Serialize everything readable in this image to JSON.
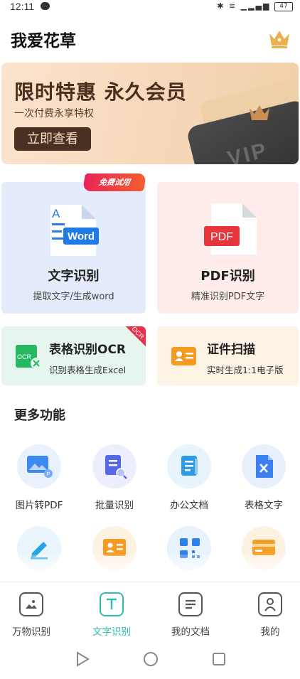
{
  "status_bar": {
    "time": "12:11",
    "battery": "47"
  },
  "header": {
    "title": "我爱花草"
  },
  "banner": {
    "title": "限时特惠 永久会员",
    "subtitle": "一次付费永享特权",
    "button_label": "立即查看",
    "card_text": "VIP"
  },
  "main_features": [
    {
      "title": "文字识别",
      "subtitle": "提取文字/生成word",
      "icon_text": "Word",
      "tag": "免费试用"
    },
    {
      "title": "PDF识别",
      "subtitle": "精准识别PDF文字",
      "icon_text": "PDF"
    }
  ],
  "secondary_features": [
    {
      "title": "表格识别OCR",
      "subtitle": "识别表格生成Excel",
      "corner_tag": "OCR",
      "icon_text": "OCR"
    },
    {
      "title": "证件扫描",
      "subtitle": "实时生成1:1电子版"
    }
  ],
  "more": {
    "title": "更多功能",
    "items": [
      {
        "label": "图片转PDF",
        "icon": "image-to-pdf-icon"
      },
      {
        "label": "批量识别",
        "icon": "batch-scan-icon"
      },
      {
        "label": "办公文档",
        "icon": "office-doc-icon"
      },
      {
        "label": "表格文字",
        "icon": "excel-text-icon"
      }
    ],
    "row2_icons": [
      "handwriting-icon",
      "id-card-icon",
      "qr-code-icon",
      "bank-card-icon"
    ]
  },
  "bottom_nav": [
    {
      "label": "万物识别",
      "icon": "photo-icon",
      "active": false
    },
    {
      "label": "文字识别",
      "icon": "text-icon",
      "active": true
    },
    {
      "label": "我的文档",
      "icon": "document-icon",
      "active": false
    },
    {
      "label": "我的",
      "icon": "profile-icon",
      "active": false
    }
  ],
  "colors": {
    "accent": "#2bbfae",
    "banner_button": "#4a2f23",
    "pdf_red": "#e8343b",
    "word_blue": "#1f7ae6"
  }
}
